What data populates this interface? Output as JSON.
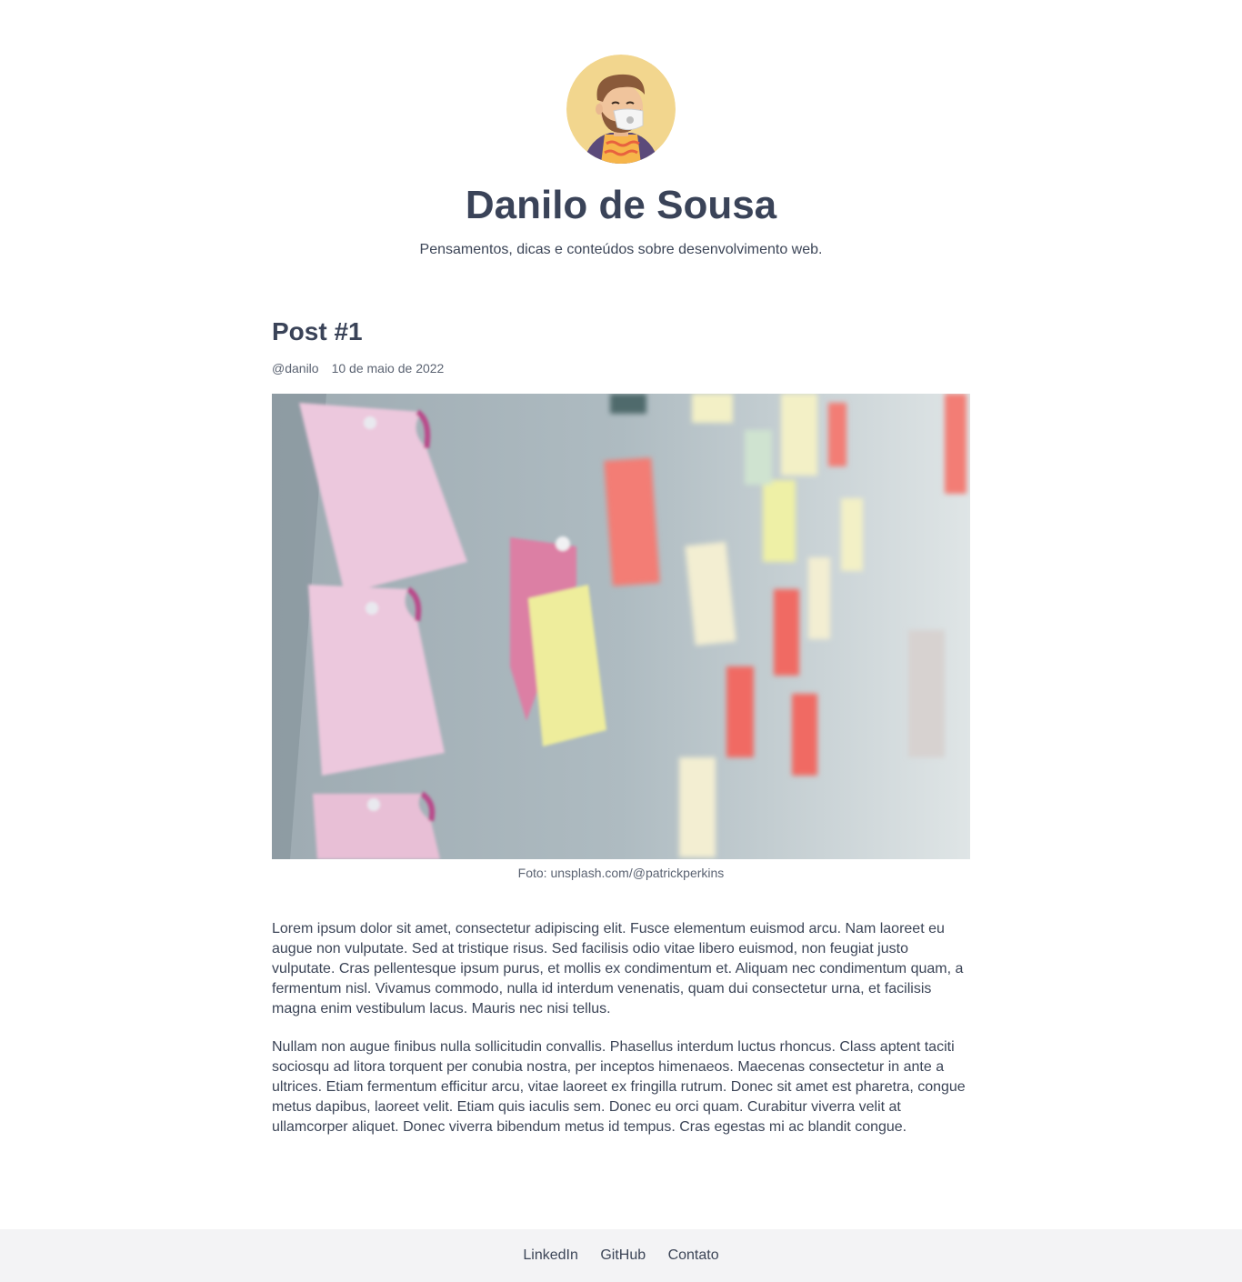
{
  "header": {
    "avatar_alt": "Avatar",
    "title": "Danilo de Sousa",
    "subtitle": "Pensamentos, dicas e conteúdos sobre desenvolvimento web."
  },
  "post": {
    "title": "Post #1",
    "author": "@danilo",
    "date": "10 de maio de 2022",
    "image_alt": "Sticky notes on a board",
    "image_caption": "Foto: unsplash.com/@patrickperkins",
    "paragraphs": [
      "Lorem ipsum dolor sit amet, consectetur adipiscing elit. Fusce elementum euismod arcu. Nam laoreet eu augue non vulputate. Sed at tristique risus. Sed facilisis odio vitae libero euismod, non feugiat justo vulputate. Cras pellentesque ipsum purus, et mollis ex condimentum et. Aliquam nec condimentum quam, a fermentum nisl. Vivamus commodo, nulla id interdum venenatis, quam dui consectetur urna, et facilisis magna enim vestibulum lacus. Mauris nec nisi tellus.",
      "Nullam non augue finibus nulla sollicitudin convallis. Phasellus interdum luctus rhoncus. Class aptent taciti sociosqu ad litora torquent per conubia nostra, per inceptos himenaeos. Maecenas consectetur in ante a ultrices. Etiam fermentum efficitur arcu, vitae laoreet ex fringilla rutrum. Donec sit amet est pharetra, congue metus dapibus, laoreet velit. Etiam quis iaculis sem. Donec eu orci quam. Curabitur viverra velit at ullamcorper aliquet. Donec viverra bibendum metus id tempus. Cras egestas mi ac blandit congue."
    ]
  },
  "footer": {
    "links": [
      "LinkedIn",
      "GitHub",
      "Contato"
    ]
  },
  "colors": {
    "text": "#3c4557",
    "footer_bg": "#f3f3f5",
    "avatar_bg": "#f2d68e"
  }
}
